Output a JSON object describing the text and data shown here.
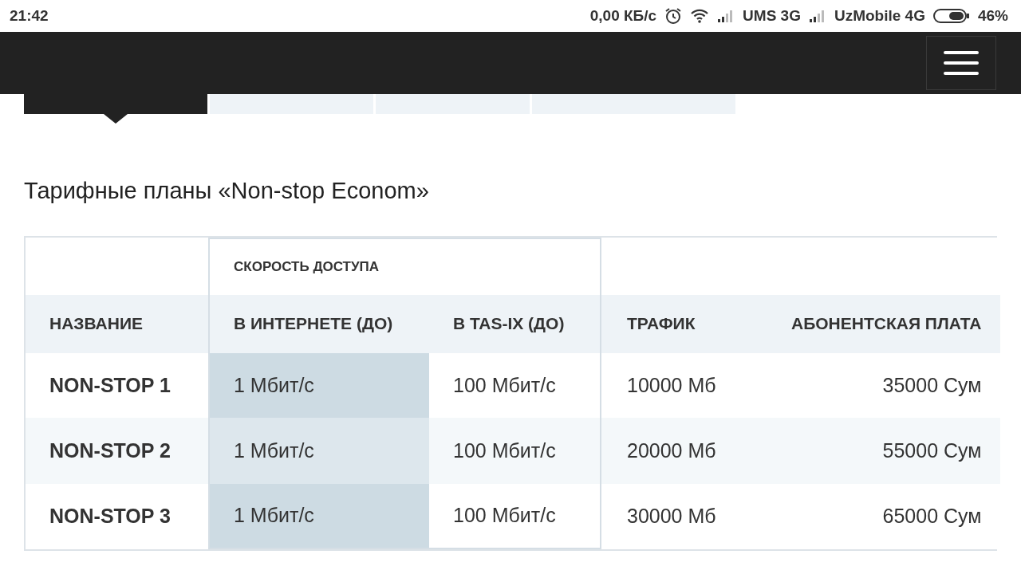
{
  "status_bar": {
    "time": "21:42",
    "speed": "0,00 КБ/с",
    "carrier_1": "UMS 3G",
    "carrier_2": "UzMobile 4G",
    "battery": "46%"
  },
  "tabs": [
    {
      "selected": true
    },
    {
      "selected": false
    },
    {
      "selected": false
    },
    {
      "selected": false
    }
  ],
  "title": "Тарифные планы «Non-stop Econom»",
  "table": {
    "group_header": "СКОРОСТЬ ДОСТУПА",
    "columns": [
      {
        "label": "НАЗВАНИЕ",
        "highlighted": false
      },
      {
        "label": "В ИНТЕРНЕТЕ (ДО)",
        "highlighted": true
      },
      {
        "label": "В TAS-IX (ДО)",
        "highlighted": false
      },
      {
        "label": "ТРАФИК",
        "highlighted": false
      },
      {
        "label": "АБОНЕНТСКАЯ ПЛАТА",
        "highlighted": false
      }
    ],
    "rows": [
      {
        "cells": [
          "NON-STOP 1",
          "1 Мбит/с",
          "100 Мбит/с",
          "10000 Мб",
          "35000 Сум"
        ]
      },
      {
        "cells": [
          "NON-STOP 2",
          "1 Мбит/с",
          "100 Мбит/с",
          "20000 Мб",
          "55000 Сум"
        ]
      },
      {
        "cells": [
          "NON-STOP 3",
          "1 Мбит/с",
          "100 Мбит/с",
          "30000 Мб",
          "65000 Сум"
        ]
      }
    ]
  }
}
